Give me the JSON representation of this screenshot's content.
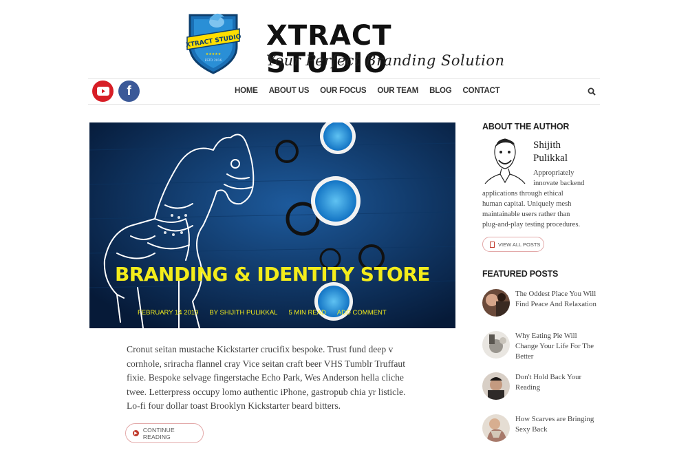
{
  "brand": {
    "name": "XTRACT STUDIO",
    "tagline": "Your Perfect Branding Solution",
    "logo_text": "XTRACT STUDIO",
    "logo_estd": "ESTD 2016"
  },
  "social": [
    {
      "icon": "youtube-icon",
      "color": "#d71e26"
    },
    {
      "icon": "facebook-icon",
      "label": "f",
      "color": "#3b5998"
    }
  ],
  "nav": {
    "items": [
      "HOME",
      "ABOUT US",
      "OUR FOCUS",
      "OUR TEAM",
      "BLOG",
      "CONTACT"
    ],
    "search_icon": "search-icon"
  },
  "hero": {
    "title": "BRANDING & IDENTITY STORE",
    "meta": [
      "FEBRUARY 14 2019",
      "BY SHIJITH PULIKKAL",
      "5 MIN READ",
      "ADD COMMENT"
    ],
    "title_color": "#f3ec1b"
  },
  "post": {
    "excerpt": "Cronut seitan mustache Kickstarter crucifix bespoke. Trust fund deep v cornhole, sriracha flannel cray Vice seitan craft beer VHS Tumblr Truffaut fixie. Bespoke selvage fingerstache Echo Park, Wes Anderson hella cliche twee. Letterpress occupy lomo authentic iPhone, gastropub chia yr listicle. Lo-fi four dollar toast Brooklyn Kickstarter beard bitters.",
    "continue_label": "CONTINUE READING"
  },
  "sidebar": {
    "about_heading": "ABOUT THE AUTHOR",
    "author_name": "Shijith Pulikkal",
    "author_bio_lines": [
      "Appropriately",
      "innovate backend",
      "applications through ethical",
      "human capital. Uniquely mesh",
      "maintainable users rather than",
      "plug-and-play testing procedures."
    ],
    "view_all_label": "VIEW ALL POSTS",
    "featured_heading": "FEATURED POSTS",
    "featured": [
      {
        "title": "The Oddest Place You Will Find Peace And Relaxation"
      },
      {
        "title": "Why Eating Pie Will Change Your Life For The Better"
      },
      {
        "title": "Don't Hold Back Your Reading"
      },
      {
        "title": "How Scarves are Bringing Sexy Back"
      }
    ]
  }
}
